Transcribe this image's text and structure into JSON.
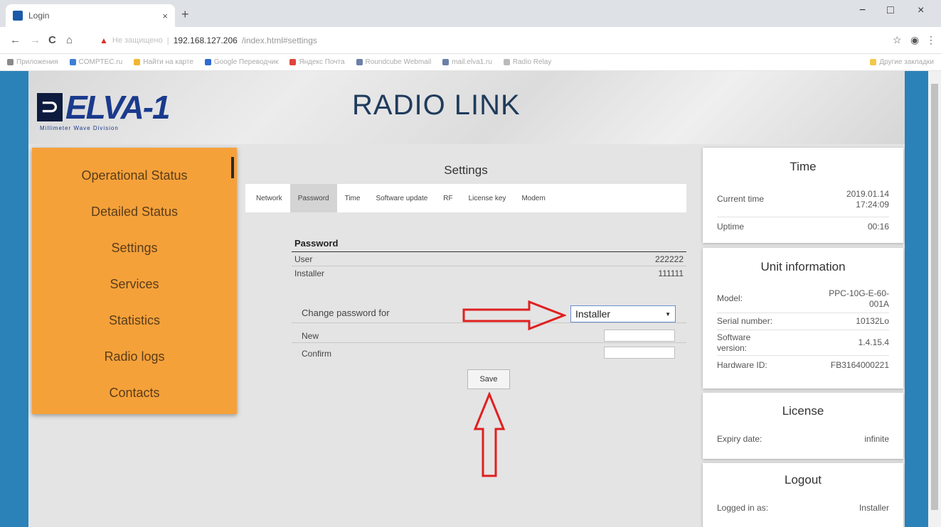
{
  "browser": {
    "tab_title": "Login",
    "tab_close": "×",
    "new_tab": "+",
    "win_minimize": "−",
    "win_maximize": "□",
    "win_close": "×",
    "nav_back": "←",
    "nav_forward": "→",
    "nav_reload": "C",
    "nav_home": "⌂",
    "not_secure_label": "Не защищено",
    "url_host": "192.168.127.206",
    "url_path": "/index.html#settings",
    "star": "☆",
    "menu": "⋮",
    "bookmarks": [
      "Приложения",
      "COMPTEC.ru",
      "Найти на карте",
      "Google Переводчик",
      "Яндекс Почта",
      "Roundcube Webmail",
      "mail.elva1.ru",
      "Radio Relay",
      "Другие закладки"
    ]
  },
  "header": {
    "logo_text": "ELVA-1",
    "logo_sub": "Millimeter Wave Division",
    "title": "RADIO LINK"
  },
  "nav": {
    "items": [
      {
        "label": "Operational Status"
      },
      {
        "label": "Detailed Status"
      },
      {
        "label": "Settings"
      },
      {
        "label": "Services"
      },
      {
        "label": "Statistics"
      },
      {
        "label": "Radio logs"
      },
      {
        "label": "Contacts"
      }
    ]
  },
  "settings": {
    "title": "Settings",
    "tabs": [
      {
        "label": "Network"
      },
      {
        "label": "Password"
      },
      {
        "label": "Time"
      },
      {
        "label": "Software update"
      },
      {
        "label": "RF"
      },
      {
        "label": "License key"
      },
      {
        "label": "Modem"
      }
    ],
    "active_tab": "Password",
    "password": {
      "heading": "Password",
      "user_label": "User",
      "user_value": "222222",
      "installer_label": "Installer",
      "installer_value": "111111",
      "change_label": "Change password for",
      "change_selected": "Installer",
      "new_label": "New",
      "confirm_label": "Confirm",
      "save_label": "Save"
    }
  },
  "time_card": {
    "title": "Time",
    "current_time_label": "Current time",
    "current_date": "2019.01.14",
    "current_clock": "17:24:09",
    "uptime_label": "Uptime",
    "uptime_value": "00:16"
  },
  "unit_card": {
    "title": "Unit information",
    "model_label": "Model:",
    "model_value": "PPC-10G-E-60-001A",
    "serial_label": "Serial number:",
    "serial_value": "10132Lo",
    "software_label": "Software version:",
    "software_value": "1.4.15.4",
    "hardware_label": "Hardware ID:",
    "hardware_value": "FB3164000221"
  },
  "license_card": {
    "title": "License",
    "expiry_label": "Expiry date:",
    "expiry_value": "infinite"
  },
  "logout_card": {
    "title": "Logout",
    "logged_label": "Logged in as:",
    "logged_value": "Installer"
  },
  "colors": {
    "page_bg": "#2a82b8",
    "nav_bg": "#f5a13a",
    "annotation_red": "#e02020",
    "title_color": "#1f3b5c"
  }
}
